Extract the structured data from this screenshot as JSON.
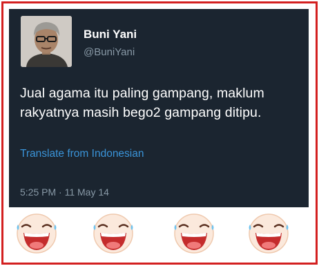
{
  "tweet": {
    "display_name": "Buni Yani",
    "handle": "@BuniYani",
    "text_line1": "Jual agama itu paling gampang, maklum",
    "text_line2": "rakyatnya masih bego2 gampang ditipu.",
    "translate_label": "Translate from Indonesian",
    "timestamp": "5:25 PM · 11 May 14"
  },
  "emojis": [
    "laughing-tears-icon",
    "laughing-tears-icon",
    "laughing-tears-icon",
    "laughing-tears-icon"
  ],
  "colors": {
    "border": "#d32020",
    "tweet_background": "#1b2530",
    "name": "#ffffff",
    "handle": "#8899a6",
    "link": "#3a94d9"
  }
}
